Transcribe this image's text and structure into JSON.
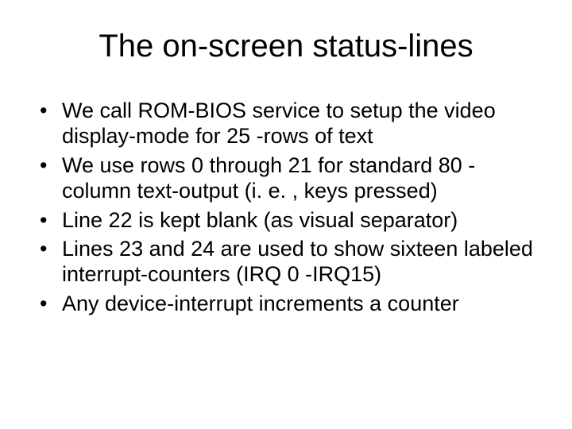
{
  "title": "The on-screen status-lines",
  "bullets": [
    "We call ROM-BIOS service to setup the video display-mode for 25 -rows of text",
    "We use rows 0 through 21 for standard 80 -column text-output (i. e. , keys pressed)",
    "Line 22 is kept blank (as visual separator)",
    "Lines 23 and 24 are used to show sixteen labeled interrupt-counters (IRQ 0 -IRQ15)",
    "Any device-interrupt increments a counter"
  ]
}
